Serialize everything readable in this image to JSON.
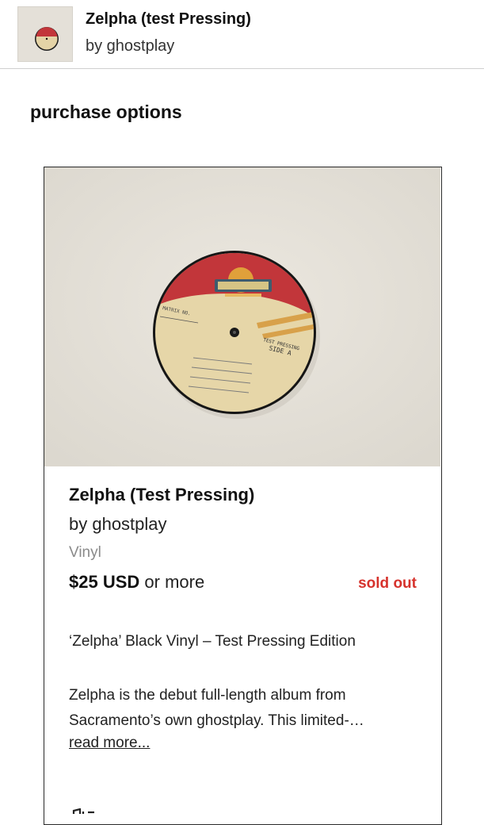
{
  "header": {
    "title": "Zelpha (test Pressing)",
    "artist": "by ghostplay"
  },
  "section": {
    "title": "purchase options"
  },
  "item": {
    "title": "Zelpha (Test Pressing)",
    "artist": "by ghostplay",
    "format": "Vinyl",
    "price": "$25 USD",
    "price_suffix": " or more",
    "status": "sold out",
    "edition": "‘Zelpha’ Black Vinyl – Test Pressing Edition",
    "description_lines": [
      "Zelpha is the debut full-length album from",
      "Sacramento’s own ghostplay. This limited-…"
    ],
    "read_more": "read more..."
  },
  "colors": {
    "sold_out": "#d6322c",
    "label_red": "#c2363a",
    "label_cream": "#e6d6a8",
    "backdrop": "#e5e1d9"
  },
  "icons": {
    "cut_off_icon": "music-note-icon"
  }
}
